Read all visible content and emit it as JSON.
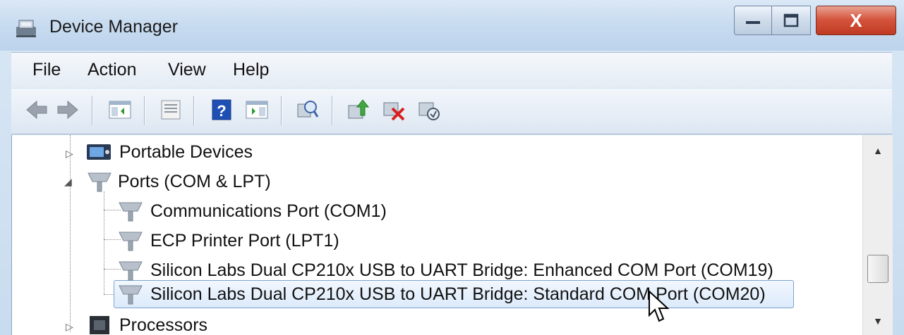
{
  "window": {
    "title": "Device Manager",
    "close_symbol": "X"
  },
  "menu": {
    "items": [
      "File",
      "Action",
      "View",
      "Help"
    ]
  },
  "toolbar": {
    "icons": [
      "back-arrow-icon",
      "forward-arrow-icon",
      "show-hide-console-tree-icon",
      "properties-icon",
      "help-icon",
      "show-hide-action-pane-icon",
      "scan-hardware-changes-icon",
      "update-driver-icon",
      "uninstall-device-icon",
      "disable-device-icon"
    ]
  },
  "tree": {
    "portable_devices": "Portable Devices",
    "ports_group": "Ports (COM & LPT)",
    "ports": [
      "Communications Port (COM1)",
      "ECP Printer Port (LPT1)",
      "Silicon Labs Dual CP210x USB to UART Bridge: Enhanced COM Port (COM19)",
      "Silicon Labs Dual CP210x USB to UART Bridge: Standard COM Port (COM20)"
    ],
    "selected_index": 3,
    "processors": "Processors"
  },
  "colors": {
    "accent": "#c03a23",
    "selection_border": "#7da2ce",
    "help_icon": "#1e4fb5"
  }
}
